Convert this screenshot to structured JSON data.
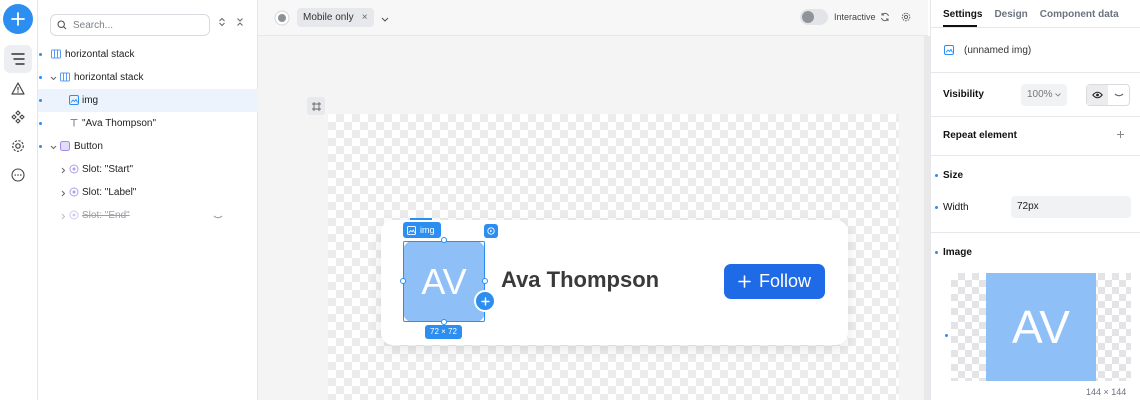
{
  "rail": {
    "items": [
      "add-icon",
      "layers-icon",
      "warning-icon",
      "components-icon",
      "settings-icon",
      "more-icon"
    ]
  },
  "layers": {
    "search_placeholder": "Search...",
    "tree": [
      {
        "label": "horizontal stack",
        "icon": "hstack-icon",
        "depth": 0,
        "expandable": false,
        "selected": false
      },
      {
        "label": "horizontal stack",
        "icon": "hstack-icon",
        "depth": 0,
        "expandable": true,
        "selected": false
      },
      {
        "label": "img",
        "icon": "image-icon",
        "depth": 1,
        "expandable": false,
        "selected": true
      },
      {
        "label": "\"Ava Thompson\"",
        "icon": "text-icon",
        "depth": 1,
        "expandable": false,
        "selected": false
      },
      {
        "label": "Button",
        "icon": "button-icon",
        "depth": 0,
        "expandable": true,
        "selected": false
      },
      {
        "label": "Slot: \"Start\"",
        "icon": "slot-icon",
        "depth": 1,
        "expandable": true,
        "selected": false
      },
      {
        "label": "Slot: \"Label\"",
        "icon": "slot-icon",
        "depth": 1,
        "expandable": true,
        "selected": false
      },
      {
        "label": "Slot: \"End\"",
        "icon": "slot-icon",
        "depth": 1,
        "expandable": true,
        "selected": false,
        "hidden": true
      }
    ]
  },
  "canvas": {
    "filter_chip": "Mobile only",
    "interactive_label": "Interactive",
    "selection_label": "img",
    "selection_size": "72 × 72",
    "avatar_initials": "AV",
    "person_name": "Ava Thompson",
    "follow_label": "Follow"
  },
  "inspector": {
    "tabs": [
      "Settings",
      "Design",
      "Component data"
    ],
    "active_tab": "Settings",
    "element_name": "(unnamed img)",
    "visibility_label": "Visibility",
    "visibility_value": "100%",
    "repeat_label": "Repeat element",
    "size_label": "Size",
    "width_label": "Width",
    "width_value": "72px",
    "image_label": "Image",
    "image_initials": "AV",
    "image_size": "144 × 144"
  },
  "colors": {
    "accent": "#2b8ef0",
    "follow_button": "#1f6ae6",
    "avatar": "#8ec0f7"
  }
}
